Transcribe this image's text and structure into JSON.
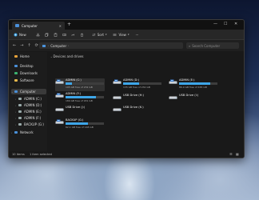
{
  "window": {
    "tab_title": "Computer",
    "tab_close": "✕",
    "new_tab": "+",
    "minimize": "—",
    "maximize": "☐",
    "close": "✕"
  },
  "toolbar": {
    "new_label": "New",
    "sort_label": "Sort",
    "view_label": "View",
    "more_label": "···"
  },
  "address": {
    "back": "←",
    "forward": "→",
    "up": "↑",
    "refresh": "⟳",
    "path": "Computer",
    "search_placeholder": "Search Computer"
  },
  "sidebar": {
    "items": [
      {
        "label": "Home",
        "icon": "home-icon",
        "color": "#e8a33a"
      },
      {
        "label": "Desktop",
        "icon": "desktop-icon",
        "color": "#4a90d9"
      },
      {
        "label": "Downloads",
        "icon": "download-icon",
        "color": "#3cb371"
      },
      {
        "label": "Software",
        "icon": "folder-icon",
        "color": "#e6b84c"
      },
      {
        "label": "Computer",
        "icon": "computer-icon",
        "color": "#4a90d9"
      },
      {
        "label": "ADMIN (C:)",
        "icon": "drive-icon",
        "color": "#9aa"
      },
      {
        "label": "ADMIN (D:)",
        "icon": "drive-icon",
        "color": "#9aa"
      },
      {
        "label": "ADMIN (E:)",
        "icon": "drive-icon",
        "color": "#9aa"
      },
      {
        "label": "ADMIN (F:)",
        "icon": "drive-icon",
        "color": "#9aa"
      },
      {
        "label": "BACKUP (G:)",
        "icon": "drive-icon",
        "color": "#9aa"
      },
      {
        "label": "Network",
        "icon": "network-icon",
        "color": "#4a90d9"
      }
    ]
  },
  "content": {
    "section_label": "Devices and drives",
    "drives": [
      {
        "name": "ADMIN (C:)",
        "free": "195 GB free of 232 GB",
        "used_fraction": 0.16
      },
      {
        "name": "ADMIN (D:)",
        "free": "135 GB free of 232 GB",
        "used_fraction": 0.42
      },
      {
        "name": "ADMIN (E:)",
        "free": "86.9 GB free of 465 GB",
        "used_fraction": 0.81
      },
      {
        "name": "ADMIN (F:)",
        "free": "189 GB free of 931 GB",
        "used_fraction": 0.8
      },
      {
        "name": "USB Drive (H:)",
        "free": "",
        "used_fraction": null
      },
      {
        "name": "USB Drive (I:)",
        "free": "",
        "used_fraction": null
      },
      {
        "name": "USB Drive (J:)",
        "free": "",
        "used_fraction": null
      },
      {
        "name": "USB Drive (K:)",
        "free": "",
        "used_fraction": null
      },
      {
        "name": "BACKUP (G:)",
        "free": "62.1 GB free of 148 GB",
        "used_fraction": 0.58
      }
    ]
  },
  "status": {
    "items_count": "10 items",
    "selected": "1 item selected"
  },
  "colors": {
    "accent": "#3ea6e8",
    "window_bg": "#191919"
  }
}
